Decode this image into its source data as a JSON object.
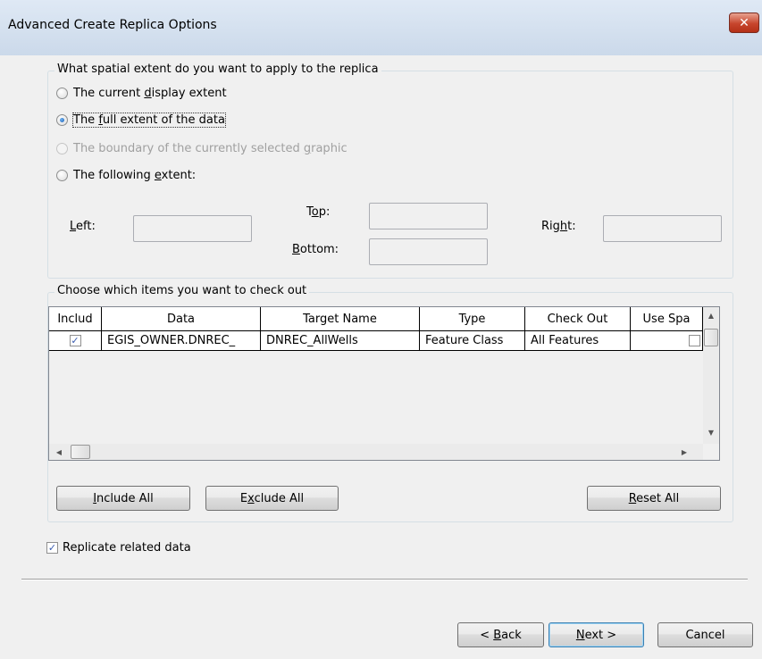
{
  "window": {
    "title": "Advanced Create Replica Options",
    "close_glyph": "✕"
  },
  "extent": {
    "group_label": "What spatial extent do you want to apply to the replica",
    "options": [
      {
        "pre": "The current ",
        "key": "d",
        "post": "isplay extent",
        "checked": false,
        "enabled": true
      },
      {
        "pre": "The ",
        "key": "f",
        "post": "ull extent of the data",
        "checked": true,
        "enabled": true
      },
      {
        "pre": "The boundary of the currently selected ",
        "key": "g",
        "post": "raphic",
        "checked": false,
        "enabled": false
      },
      {
        "pre": "The following ",
        "key": "e",
        "post": "xtent:",
        "checked": false,
        "enabled": true
      }
    ],
    "left": {
      "key": "L",
      "rest": "eft:",
      "value": ""
    },
    "top": {
      "pre": "T",
      "key": "o",
      "post": "p:",
      "value": ""
    },
    "bottom": {
      "key": "B",
      "rest": "ottom:",
      "value": ""
    },
    "right": {
      "pre": "Rig",
      "key": "h",
      "post": "t:",
      "value": ""
    }
  },
  "items": {
    "group_label": "Choose which items you want to check out",
    "columns": [
      "Includ",
      "Data",
      "Target Name",
      "Type",
      "Check Out",
      "Use Spa"
    ],
    "rows": [
      {
        "include": true,
        "data": "EGIS_OWNER.DNREC_",
        "target_name": "DNREC_AllWells",
        "type": "Feature Class",
        "check_out": "All Features",
        "use_spatial": false
      }
    ],
    "include_all": {
      "key": "I",
      "rest": "nclude All"
    },
    "exclude_all": {
      "pre": "E",
      "key": "x",
      "post": "clude All"
    },
    "reset_all": {
      "key": "R",
      "rest": "eset All"
    }
  },
  "replicate_related": {
    "label": "Replicate related data",
    "checked": true
  },
  "footer": {
    "back": {
      "pre": "< ",
      "key": "B",
      "post": "ack"
    },
    "next": {
      "key": "N",
      "post": "ext >"
    },
    "cancel": "Cancel"
  },
  "icons": {
    "check": "✓",
    "scroll_up": "▲",
    "scroll_down": "▼",
    "scroll_left": "◀",
    "scroll_right": "▶"
  }
}
